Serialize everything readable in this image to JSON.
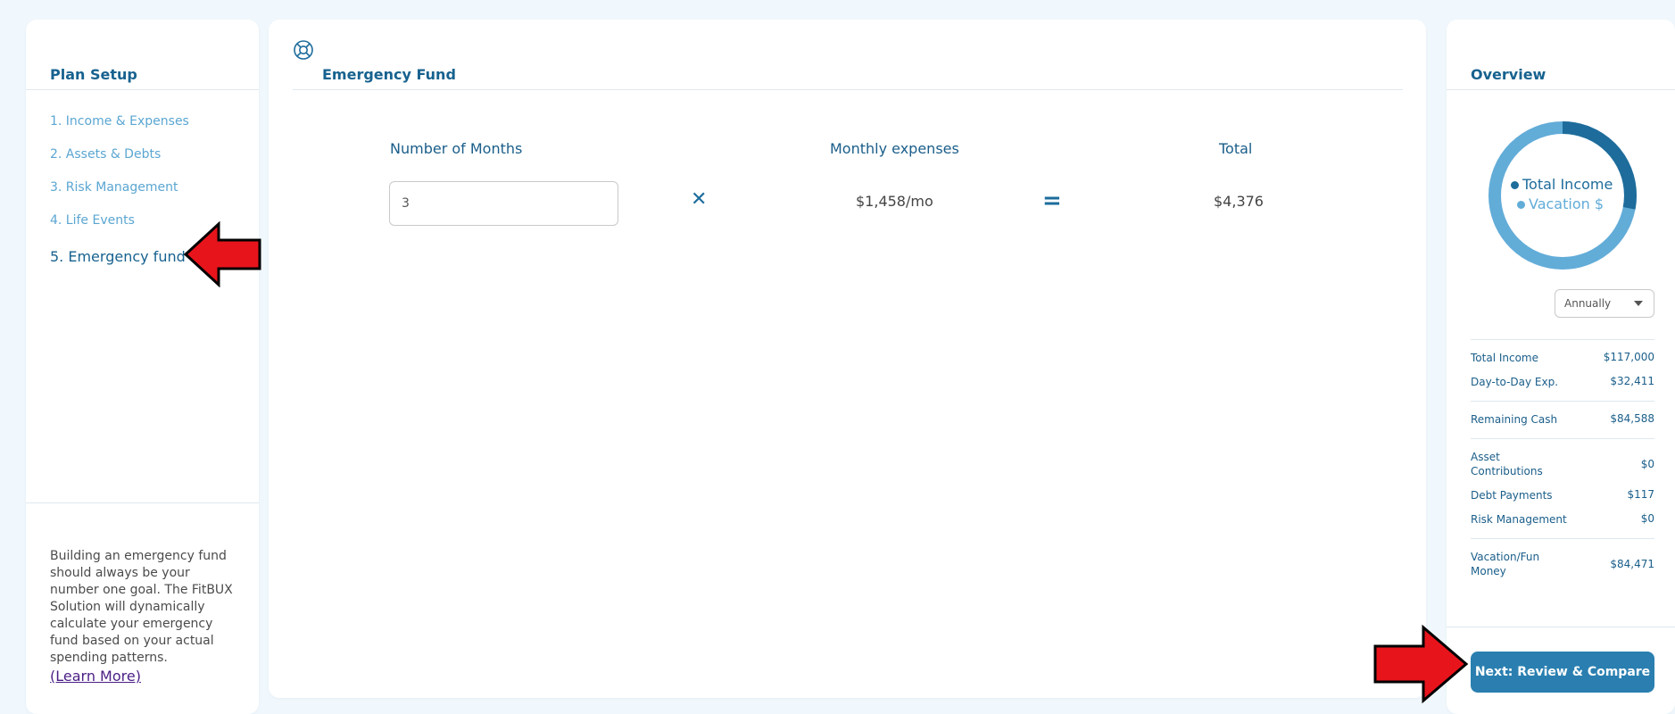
{
  "left": {
    "title": "Plan Setup",
    "steps": [
      {
        "label": "1. Income & Expenses"
      },
      {
        "label": "2. Assets & Debts"
      },
      {
        "label": "3. Risk Management"
      },
      {
        "label": "4. Life Events"
      },
      {
        "label": "5. Emergency fund"
      }
    ],
    "active_step": "5. Emergency fund",
    "description": "Building an emergency fund should always be your number one goal. The FitBUX Solution will dynamically calculate your emergency fund based on your actual spending patterns.",
    "learn_more": "(Learn More)"
  },
  "main": {
    "title": "Emergency Fund",
    "icon": "lifebuoy-icon",
    "columns": {
      "months": "Number of Months",
      "expenses": "Monthly expenses",
      "total": "Total"
    },
    "months_value": "3",
    "multiply_symbol": "✕",
    "equals_symbol": "=",
    "monthly_expenses": "$1,458/mo",
    "total": "$4,376"
  },
  "overview": {
    "title": "Overview",
    "donut": {
      "legend": [
        {
          "label": "Total Income",
          "color": "#1e6c9b"
        },
        {
          "label": "Vacation $",
          "color": "#62acd8"
        }
      ],
      "segments": [
        {
          "label": "Total Income",
          "fraction": 0.28,
          "color": "#1e6c9b"
        },
        {
          "label": "Vacation $",
          "fraction": 0.72,
          "color": "#62acd8"
        }
      ]
    },
    "period": "Annually",
    "rows": [
      {
        "label": "Total Income",
        "value": "$117,000"
      },
      {
        "label": "Day-to-Day Exp.",
        "value": "$32,411"
      },
      {
        "label": "Remaining Cash",
        "value": "$84,588"
      },
      {
        "label": "Asset Contributions",
        "value": "$0"
      },
      {
        "label": "Debt Payments",
        "value": "$117"
      },
      {
        "label": "Risk Management",
        "value": "$0"
      },
      {
        "label": "Vacation/Fun Money",
        "value": "$84,471"
      }
    ],
    "next_button": "Next: Review & Compare"
  },
  "colors": {
    "background": "#f1f8fd",
    "primary": "#17628f",
    "accent": "#2a7fb0",
    "link": "#5ba6d2",
    "annotation_arrow": "#e8141c"
  }
}
